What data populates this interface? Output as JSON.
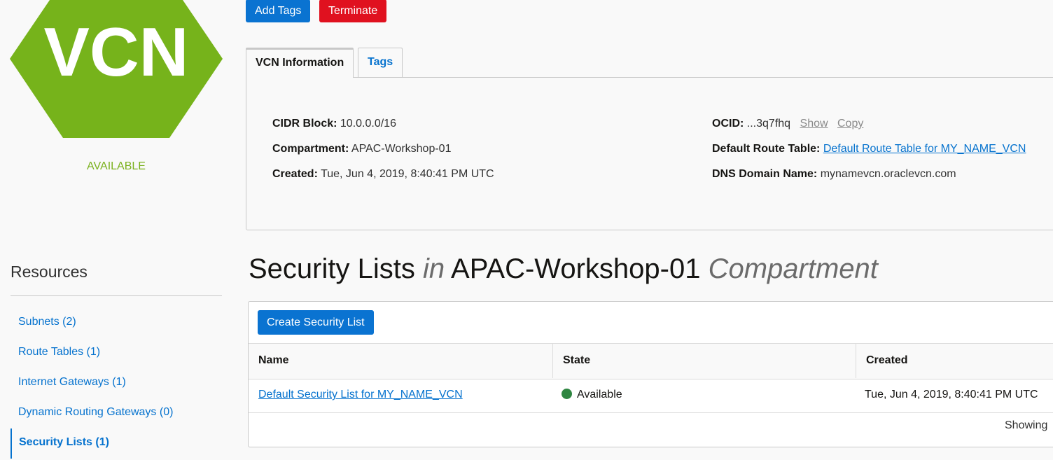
{
  "vcn": {
    "icon_text": "VCN",
    "status": "AVAILABLE",
    "status_color": "#7bb11e",
    "hex_color": "#76b31b"
  },
  "actions": {
    "add_tags": "Add Tags",
    "terminate": "Terminate"
  },
  "tabs": [
    {
      "label": "VCN Information",
      "active": true
    },
    {
      "label": "Tags",
      "active": false
    }
  ],
  "info": {
    "cidr_label": "CIDR Block:",
    "cidr_value": "10.0.0.0/16",
    "compartment_label": "Compartment:",
    "compartment_value": "APAC-Workshop-01",
    "created_label": "Created:",
    "created_value": "Tue, Jun 4, 2019, 8:40:41 PM UTC",
    "ocid_label": "OCID:",
    "ocid_value": "...3q7fhq",
    "ocid_show": "Show",
    "ocid_copy": "Copy",
    "route_label": "Default Route Table:",
    "route_value": "Default Route Table for MY_NAME_VCN",
    "dns_label": "DNS Domain Name:",
    "dns_value": "mynamevcn.oraclevcn.com"
  },
  "resources": {
    "title": "Resources",
    "items": [
      {
        "label": "Subnets (2)",
        "active": false
      },
      {
        "label": "Route Tables (1)",
        "active": false
      },
      {
        "label": "Internet Gateways (1)",
        "active": false
      },
      {
        "label": "Dynamic Routing Gateways (0)",
        "active": false
      },
      {
        "label": "Security Lists (1)",
        "active": true
      }
    ]
  },
  "security_lists": {
    "heading_main": "Security Lists",
    "heading_in": "in",
    "heading_compartment": "APAC-Workshop-01",
    "heading_suffix": "Compartment",
    "create_button": "Create Security List",
    "columns": [
      "Name",
      "State",
      "Created"
    ],
    "rows": [
      {
        "name": "Default Security List for MY_NAME_VCN",
        "state": "Available",
        "state_color": "#2e8540",
        "created": "Tue, Jun 4, 2019, 8:40:41 PM UTC"
      }
    ],
    "footer": "Showing"
  },
  "colors": {
    "link": "#0572ce",
    "primary_button": "#0a73d1",
    "danger_button": "#e0111f"
  }
}
